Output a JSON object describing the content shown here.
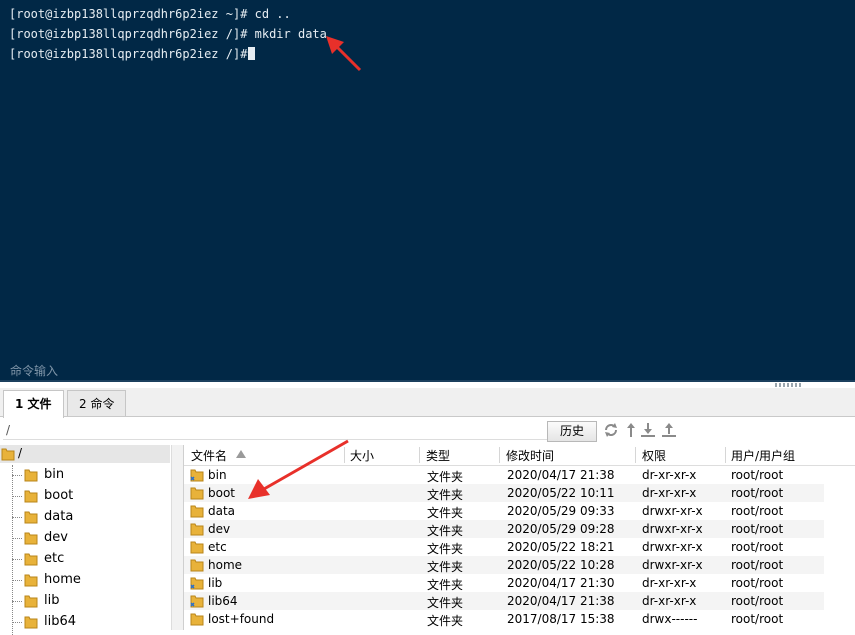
{
  "terminal": {
    "lines": [
      "[root@izbp138llqprzqdhr6p2iez ~]# cd ..",
      "[root@izbp138llqprzqdhr6p2iez /]# mkdir data",
      "[root@izbp138llqprzqdhr6p2iez /]#"
    ],
    "command_input_label": "命令输入"
  },
  "tabs": [
    {
      "label": "1 文件",
      "active": true
    },
    {
      "label": "2 命令",
      "active": false
    }
  ],
  "pathbar": {
    "path": "/",
    "history_label": "历史"
  },
  "tree": {
    "root": "/",
    "items": [
      "bin",
      "boot",
      "data",
      "dev",
      "etc",
      "home",
      "lib",
      "lib64"
    ]
  },
  "filelist": {
    "columns": [
      "文件名",
      "大小",
      "类型",
      "修改时间",
      "权限",
      "用户/用户组"
    ],
    "rows": [
      {
        "name": "bin",
        "size": "",
        "type": "文件夹",
        "mtime": "2020/04/17 21:38",
        "perm": "dr-xr-xr-x",
        "owner": "root/root",
        "link": true
      },
      {
        "name": "boot",
        "size": "",
        "type": "文件夹",
        "mtime": "2020/05/22 10:11",
        "perm": "dr-xr-xr-x",
        "owner": "root/root",
        "link": false
      },
      {
        "name": "data",
        "size": "",
        "type": "文件夹",
        "mtime": "2020/05/29 09:33",
        "perm": "drwxr-xr-x",
        "owner": "root/root",
        "link": false
      },
      {
        "name": "dev",
        "size": "",
        "type": "文件夹",
        "mtime": "2020/05/29 09:28",
        "perm": "drwxr-xr-x",
        "owner": "root/root",
        "link": false
      },
      {
        "name": "etc",
        "size": "",
        "type": "文件夹",
        "mtime": "2020/05/22 18:21",
        "perm": "drwxr-xr-x",
        "owner": "root/root",
        "link": false
      },
      {
        "name": "home",
        "size": "",
        "type": "文件夹",
        "mtime": "2020/05/22 10:28",
        "perm": "drwxr-xr-x",
        "owner": "root/root",
        "link": false
      },
      {
        "name": "lib",
        "size": "",
        "type": "文件夹",
        "mtime": "2020/04/17 21:30",
        "perm": "dr-xr-xr-x",
        "owner": "root/root",
        "link": true
      },
      {
        "name": "lib64",
        "size": "",
        "type": "文件夹",
        "mtime": "2020/04/17 21:38",
        "perm": "dr-xr-xr-x",
        "owner": "root/root",
        "link": true
      },
      {
        "name": "lost+found",
        "size": "",
        "type": "文件夹",
        "mtime": "2017/08/17 15:38",
        "perm": "drwx------",
        "owner": "root/root",
        "link": false
      }
    ]
  },
  "colors": {
    "terminal_bg": "#012846",
    "annotation_arrow": "#e8302a",
    "folder": "#e8b23a"
  }
}
